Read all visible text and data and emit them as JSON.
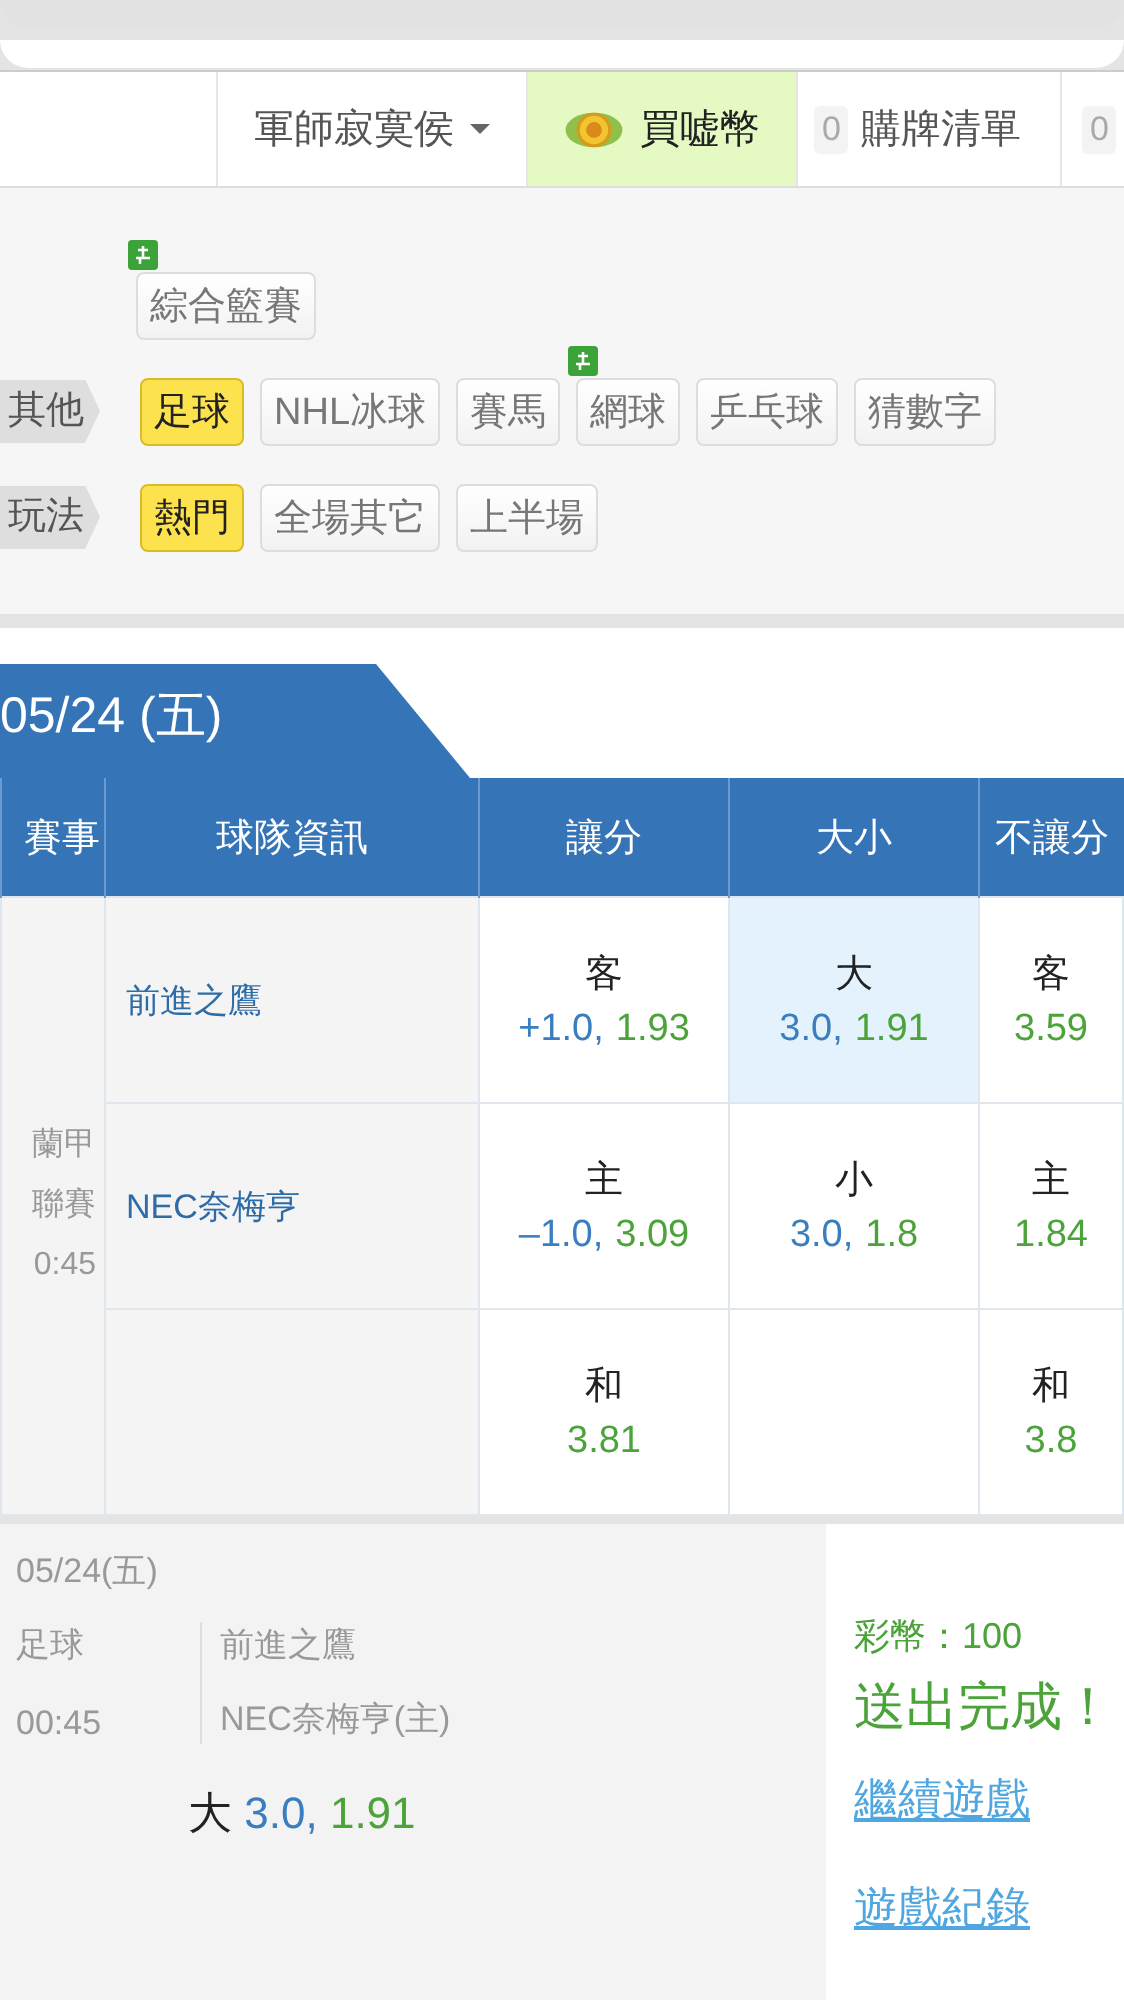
{
  "header": {
    "user": "軍師寂寞侯",
    "coin_button": "買嘘幣",
    "cart": {
      "count": "0",
      "label": "購牌清單"
    },
    "extra_count": "0"
  },
  "filters": [
    {
      "tags": [
        {
          "label": "綜合籃賽",
          "selected": false,
          "live": true
        }
      ]
    },
    {
      "label": "其他",
      "tags": [
        {
          "label": "足球",
          "selected": true,
          "live": false
        },
        {
          "label": "NHL冰球",
          "selected": false,
          "live": false
        },
        {
          "label": "賽馬",
          "selected": false,
          "live": false
        },
        {
          "label": "網球",
          "selected": false,
          "live": true
        },
        {
          "label": "乒乓球",
          "selected": false,
          "live": false
        },
        {
          "label": "猜數字",
          "selected": false,
          "live": false
        }
      ]
    },
    {
      "label": "玩法",
      "tags": [
        {
          "label": "熱門",
          "selected": true,
          "live": false
        },
        {
          "label": "全場其它",
          "selected": false,
          "live": false
        },
        {
          "label": "上半場",
          "selected": false,
          "live": false
        }
      ]
    }
  ],
  "date_tab": "05/24 (五)",
  "table": {
    "columns": [
      "賽事",
      "球隊資訊",
      "讓分",
      "大小",
      "不讓分"
    ],
    "event": [
      "蘭甲",
      "聯賽",
      "0:45"
    ],
    "rows": [
      {
        "team": "前進之鷹",
        "handicap": {
          "side": "客",
          "line": "+1.0,",
          "odds": "1.93",
          "selected": false
        },
        "total": {
          "side": "大",
          "line": "3.0,",
          "odds": "1.91",
          "selected": true
        },
        "moneyline": {
          "side": "客",
          "odds": "3.59",
          "selected": false
        }
      },
      {
        "team": "NEC奈梅亨",
        "handicap": {
          "side": "主",
          "line": "–1.0,",
          "odds": "3.09",
          "selected": false
        },
        "total": {
          "side": "小",
          "line": "3.0,",
          "odds": "1.8",
          "selected": false
        },
        "moneyline": {
          "side": "主",
          "odds": "1.84",
          "selected": false
        }
      },
      {
        "handicap": {
          "side": "和",
          "odds": "3.81",
          "selected": false
        },
        "total": null,
        "moneyline": {
          "side": "和",
          "odds": "3.8",
          "selected": false
        }
      }
    ]
  },
  "receipt": {
    "date": "05/24(五)",
    "sport": "足球",
    "time": "00:45",
    "teams": [
      "前進之鷹",
      "NEC奈梅亨(主)"
    ],
    "pick": {
      "side": "大",
      "line": "3.0,",
      "odds": "1.91"
    },
    "coins": "彩幣：100",
    "status": "送出完成！",
    "links": [
      "繼續遊戲",
      "遊戲紀錄"
    ]
  }
}
